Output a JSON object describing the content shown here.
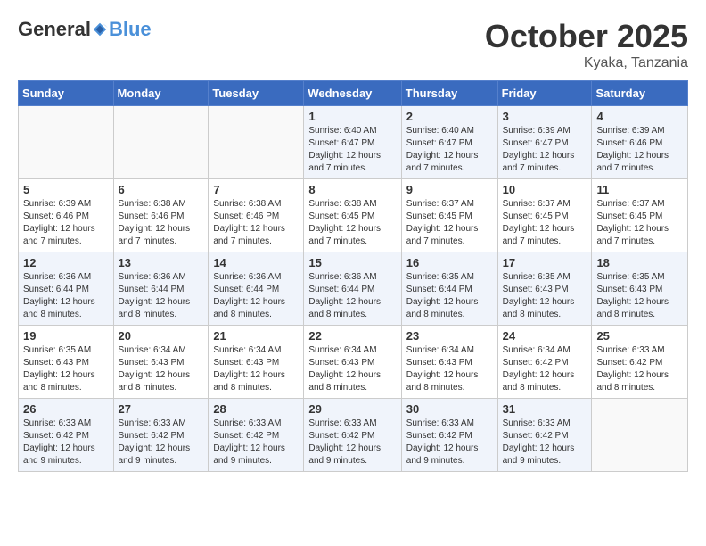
{
  "header": {
    "logo_general": "General",
    "logo_blue": "Blue",
    "month_title": "October 2025",
    "location": "Kyaka, Tanzania"
  },
  "days_of_week": [
    "Sunday",
    "Monday",
    "Tuesday",
    "Wednesday",
    "Thursday",
    "Friday",
    "Saturday"
  ],
  "weeks": [
    [
      {
        "day": "",
        "info": ""
      },
      {
        "day": "",
        "info": ""
      },
      {
        "day": "",
        "info": ""
      },
      {
        "day": "1",
        "info": "Sunrise: 6:40 AM\nSunset: 6:47 PM\nDaylight: 12 hours\nand 7 minutes."
      },
      {
        "day": "2",
        "info": "Sunrise: 6:40 AM\nSunset: 6:47 PM\nDaylight: 12 hours\nand 7 minutes."
      },
      {
        "day": "3",
        "info": "Sunrise: 6:39 AM\nSunset: 6:47 PM\nDaylight: 12 hours\nand 7 minutes."
      },
      {
        "day": "4",
        "info": "Sunrise: 6:39 AM\nSunset: 6:46 PM\nDaylight: 12 hours\nand 7 minutes."
      }
    ],
    [
      {
        "day": "5",
        "info": "Sunrise: 6:39 AM\nSunset: 6:46 PM\nDaylight: 12 hours\nand 7 minutes."
      },
      {
        "day": "6",
        "info": "Sunrise: 6:38 AM\nSunset: 6:46 PM\nDaylight: 12 hours\nand 7 minutes."
      },
      {
        "day": "7",
        "info": "Sunrise: 6:38 AM\nSunset: 6:46 PM\nDaylight: 12 hours\nand 7 minutes."
      },
      {
        "day": "8",
        "info": "Sunrise: 6:38 AM\nSunset: 6:45 PM\nDaylight: 12 hours\nand 7 minutes."
      },
      {
        "day": "9",
        "info": "Sunrise: 6:37 AM\nSunset: 6:45 PM\nDaylight: 12 hours\nand 7 minutes."
      },
      {
        "day": "10",
        "info": "Sunrise: 6:37 AM\nSunset: 6:45 PM\nDaylight: 12 hours\nand 7 minutes."
      },
      {
        "day": "11",
        "info": "Sunrise: 6:37 AM\nSunset: 6:45 PM\nDaylight: 12 hours\nand 7 minutes."
      }
    ],
    [
      {
        "day": "12",
        "info": "Sunrise: 6:36 AM\nSunset: 6:44 PM\nDaylight: 12 hours\nand 8 minutes."
      },
      {
        "day": "13",
        "info": "Sunrise: 6:36 AM\nSunset: 6:44 PM\nDaylight: 12 hours\nand 8 minutes."
      },
      {
        "day": "14",
        "info": "Sunrise: 6:36 AM\nSunset: 6:44 PM\nDaylight: 12 hours\nand 8 minutes."
      },
      {
        "day": "15",
        "info": "Sunrise: 6:36 AM\nSunset: 6:44 PM\nDaylight: 12 hours\nand 8 minutes."
      },
      {
        "day": "16",
        "info": "Sunrise: 6:35 AM\nSunset: 6:44 PM\nDaylight: 12 hours\nand 8 minutes."
      },
      {
        "day": "17",
        "info": "Sunrise: 6:35 AM\nSunset: 6:43 PM\nDaylight: 12 hours\nand 8 minutes."
      },
      {
        "day": "18",
        "info": "Sunrise: 6:35 AM\nSunset: 6:43 PM\nDaylight: 12 hours\nand 8 minutes."
      }
    ],
    [
      {
        "day": "19",
        "info": "Sunrise: 6:35 AM\nSunset: 6:43 PM\nDaylight: 12 hours\nand 8 minutes."
      },
      {
        "day": "20",
        "info": "Sunrise: 6:34 AM\nSunset: 6:43 PM\nDaylight: 12 hours\nand 8 minutes."
      },
      {
        "day": "21",
        "info": "Sunrise: 6:34 AM\nSunset: 6:43 PM\nDaylight: 12 hours\nand 8 minutes."
      },
      {
        "day": "22",
        "info": "Sunrise: 6:34 AM\nSunset: 6:43 PM\nDaylight: 12 hours\nand 8 minutes."
      },
      {
        "day": "23",
        "info": "Sunrise: 6:34 AM\nSunset: 6:43 PM\nDaylight: 12 hours\nand 8 minutes."
      },
      {
        "day": "24",
        "info": "Sunrise: 6:34 AM\nSunset: 6:42 PM\nDaylight: 12 hours\nand 8 minutes."
      },
      {
        "day": "25",
        "info": "Sunrise: 6:33 AM\nSunset: 6:42 PM\nDaylight: 12 hours\nand 8 minutes."
      }
    ],
    [
      {
        "day": "26",
        "info": "Sunrise: 6:33 AM\nSunset: 6:42 PM\nDaylight: 12 hours\nand 9 minutes."
      },
      {
        "day": "27",
        "info": "Sunrise: 6:33 AM\nSunset: 6:42 PM\nDaylight: 12 hours\nand 9 minutes."
      },
      {
        "day": "28",
        "info": "Sunrise: 6:33 AM\nSunset: 6:42 PM\nDaylight: 12 hours\nand 9 minutes."
      },
      {
        "day": "29",
        "info": "Sunrise: 6:33 AM\nSunset: 6:42 PM\nDaylight: 12 hours\nand 9 minutes."
      },
      {
        "day": "30",
        "info": "Sunrise: 6:33 AM\nSunset: 6:42 PM\nDaylight: 12 hours\nand 9 minutes."
      },
      {
        "day": "31",
        "info": "Sunrise: 6:33 AM\nSunset: 6:42 PM\nDaylight: 12 hours\nand 9 minutes."
      },
      {
        "day": "",
        "info": ""
      }
    ]
  ]
}
